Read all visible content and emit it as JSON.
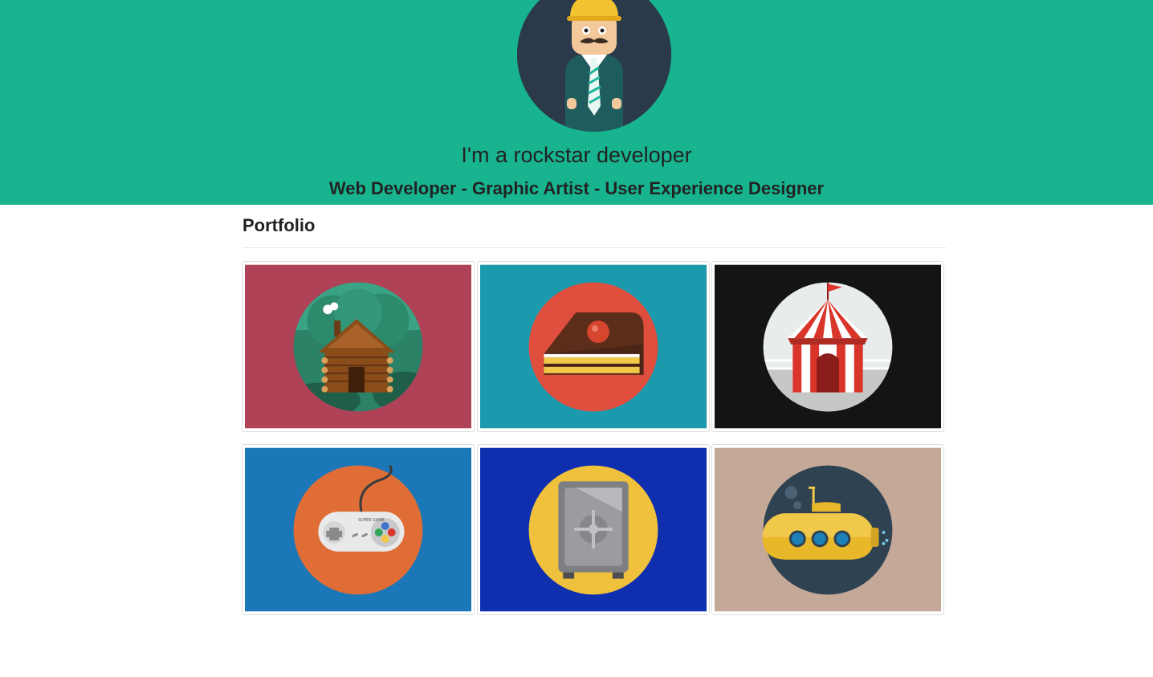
{
  "hero": {
    "background": "#17b48f",
    "title": "I'm a rockstar developer",
    "subtitle": "Web Developer - Graphic Artist - User Experience Designer"
  },
  "portfolio": {
    "heading": "Portfolio",
    "items": [
      {
        "icon": "log-cabin-icon",
        "background": "#b04258"
      },
      {
        "icon": "cake-slice-icon",
        "background": "#1b9aad"
      },
      {
        "icon": "circus-tent-icon",
        "background": "#141414"
      },
      {
        "icon": "game-controller-icon",
        "background": "#1b77b8",
        "controller_text": "SUPER GAME"
      },
      {
        "icon": "safe-icon",
        "background": "#0f2fae"
      },
      {
        "icon": "submarine-icon",
        "background": "#c4a898"
      }
    ]
  }
}
